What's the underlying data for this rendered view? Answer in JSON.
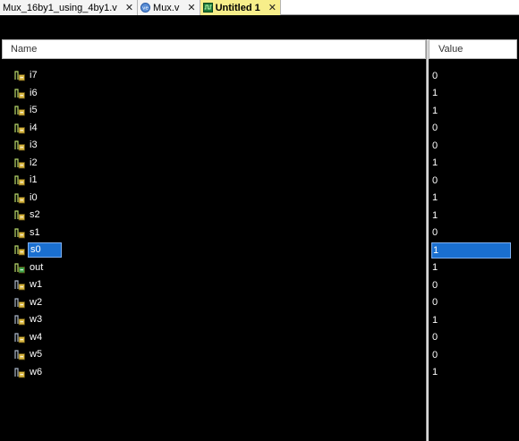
{
  "tabs": [
    {
      "label": "Mux_16by1_using_4by1.v",
      "icon": "none",
      "active": false
    },
    {
      "label": "Mux.v",
      "icon": "verilog-file-icon",
      "active": false
    },
    {
      "label": "Untitled 1",
      "icon": "waveform-icon",
      "active": true
    }
  ],
  "tab_close_glyph": "✕",
  "columns": {
    "name": "Name",
    "value": "Value"
  },
  "signals": [
    {
      "name": "i7",
      "value": "0",
      "kind": "input"
    },
    {
      "name": "i6",
      "value": "1",
      "kind": "input"
    },
    {
      "name": "i5",
      "value": "1",
      "kind": "input"
    },
    {
      "name": "i4",
      "value": "0",
      "kind": "input"
    },
    {
      "name": "i3",
      "value": "0",
      "kind": "input"
    },
    {
      "name": "i2",
      "value": "1",
      "kind": "input"
    },
    {
      "name": "i1",
      "value": "0",
      "kind": "input"
    },
    {
      "name": "i0",
      "value": "1",
      "kind": "input"
    },
    {
      "name": "s2",
      "value": "1",
      "kind": "input"
    },
    {
      "name": "s1",
      "value": "0",
      "kind": "input"
    },
    {
      "name": "s0",
      "value": "1",
      "kind": "input",
      "selected": true
    },
    {
      "name": "out",
      "value": "1",
      "kind": "output"
    },
    {
      "name": "w1",
      "value": "0",
      "kind": "wire"
    },
    {
      "name": "w2",
      "value": "0",
      "kind": "wire"
    },
    {
      "name": "w3",
      "value": "1",
      "kind": "wire"
    },
    {
      "name": "w4",
      "value": "0",
      "kind": "wire"
    },
    {
      "name": "w5",
      "value": "0",
      "kind": "wire"
    },
    {
      "name": "w6",
      "value": "1",
      "kind": "wire"
    }
  ],
  "colors": {
    "active_tab": "#f7ee8a",
    "selection": "#1a6fd0",
    "background": "#000000"
  }
}
